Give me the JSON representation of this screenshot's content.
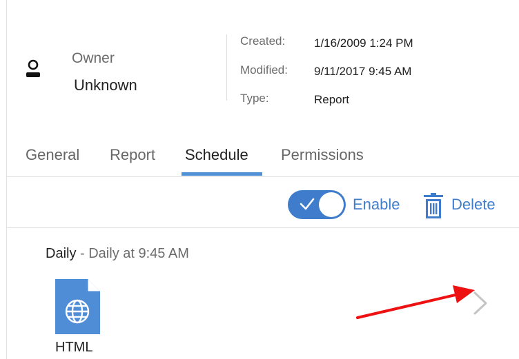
{
  "owner": {
    "label": "Owner",
    "value": "Unknown",
    "icon": "user-icon"
  },
  "meta": {
    "created_label": "Created:",
    "created_value": "1/16/2009 1:24 PM",
    "modified_label": "Modified:",
    "modified_value": "9/11/2017 9:45 AM",
    "type_label": "Type:",
    "type_value": "Report"
  },
  "tabs": [
    {
      "label": "General",
      "active": false
    },
    {
      "label": "Report",
      "active": false
    },
    {
      "label": "Schedule",
      "active": true
    },
    {
      "label": "Permissions",
      "active": false
    }
  ],
  "toolbar": {
    "enable_label": "Enable",
    "enable_on": true,
    "delete_label": "Delete"
  },
  "schedule": {
    "frequency": "Daily",
    "separator": " - ",
    "description": "Daily at 9:45 AM",
    "format_label": "HTML",
    "format_icon": "globe-document-icon"
  },
  "colors": {
    "accent": "#3f7dcc",
    "tab_underline": "#4f90d6",
    "file_icon": "#4f8dd6",
    "annotation_arrow": "#ee1111"
  }
}
